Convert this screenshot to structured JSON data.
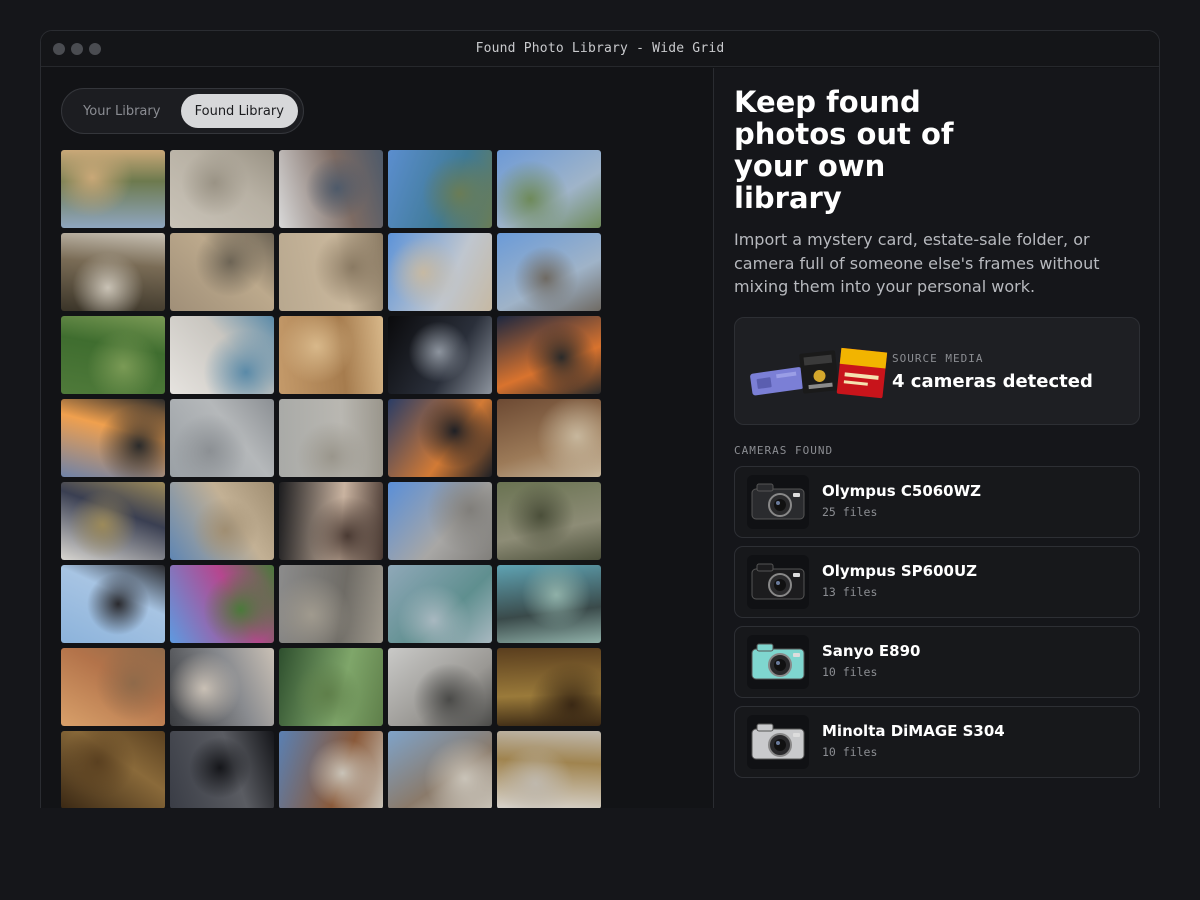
{
  "window": {
    "title": "Found Photo Library - Wide Grid"
  },
  "library_toggle": {
    "options": [
      "Your Library",
      "Found Library"
    ],
    "selected": "Found Library"
  },
  "photo_grid": {
    "tiles": [
      {
        "subject": "playground with kids and balloons",
        "colors": [
          "#8fa6c0",
          "#6d7a4e",
          "#c9a878"
        ]
      },
      {
        "subject": "sand drawing on beach",
        "colors": [
          "#c9c3b8",
          "#b8b1a4",
          "#9a9385"
        ]
      },
      {
        "subject": "photo collage poster on stand",
        "colors": [
          "#d8d8d8",
          "#7d6b63",
          "#4e5a6a"
        ]
      },
      {
        "subject": "resort pool with palm trees",
        "colors": [
          "#5b8ecf",
          "#3f7a95",
          "#6a7c56"
        ]
      },
      {
        "subject": "coastal lawn and blue sky",
        "colors": [
          "#6d9ad6",
          "#9fb4c9",
          "#6e8a5a"
        ]
      },
      {
        "subject": "kids at picnic table",
        "colors": [
          "#3a3428",
          "#7a6c56",
          "#c9c2b5"
        ]
      },
      {
        "subject": "child on balance bike",
        "colors": [
          "#a08f78",
          "#bca98c",
          "#6d6455"
        ]
      },
      {
        "subject": "kids riding balance bikes",
        "colors": [
          "#b8a88f",
          "#c9b79c",
          "#8a7a63"
        ]
      },
      {
        "subject": "military cargo plane",
        "colors": [
          "#5d93d8",
          "#bfc6cf",
          "#c6b9a3"
        ]
      },
      {
        "subject": "vintage airplane nose",
        "colors": [
          "#6b9bd8",
          "#9fb3c8",
          "#6f6a63"
        ]
      },
      {
        "subject": "garden lawn with chairs",
        "colors": [
          "#4f7a3a",
          "#3f6d2f",
          "#7a9a55"
        ]
      },
      {
        "subject": "birthday cakes on table",
        "colors": [
          "#e6e3df",
          "#c9c6c0",
          "#5a8aa8"
        ]
      },
      {
        "subject": "blurry party lights",
        "colors": [
          "#c49a6a",
          "#a67c4e",
          "#d8b88a"
        ]
      },
      {
        "subject": "palm frond at night",
        "colors": [
          "#0a0a0c",
          "#2a2f3a",
          "#8d949e"
        ]
      },
      {
        "subject": "sunset over hills",
        "colors": [
          "#1d2740",
          "#d9732e",
          "#2a2a2a"
        ]
      },
      {
        "subject": "sunset over ocean",
        "colors": [
          "#6e82a8",
          "#f0a04e",
          "#2b2b2b"
        ]
      },
      {
        "subject": "foggy sky and kite",
        "colors": [
          "#9aa0a5",
          "#b5b8ba",
          "#8c9094"
        ]
      },
      {
        "subject": "hazy beach",
        "colors": [
          "#a9aaa7",
          "#b9b7b1",
          "#9a968c"
        ]
      },
      {
        "subject": "dusk sky over sea",
        "colors": [
          "#2b3d66",
          "#d27a35",
          "#1f2025"
        ]
      },
      {
        "subject": "living room interior",
        "colors": [
          "#6d4a33",
          "#9c7a58",
          "#c7b79d"
        ]
      },
      {
        "subject": "framed ship painting",
        "colors": [
          "#d8d6d1",
          "#3a3f52",
          "#9c8a5a"
        ]
      },
      {
        "subject": "person walking on beach",
        "colors": [
          "#5f86b3",
          "#c3b195",
          "#a08e72"
        ]
      },
      {
        "subject": "woman portrait",
        "colors": [
          "#1d1d1f",
          "#c9b3a0",
          "#4a3a33"
        ]
      },
      {
        "subject": "stone sculpture",
        "colors": [
          "#5a8fd8",
          "#a8a7a5",
          "#807e7a"
        ]
      },
      {
        "subject": "bare branches",
        "colors": [
          "#6a7352",
          "#8d8c76",
          "#4b4f3a"
        ]
      },
      {
        "subject": "two birds on post",
        "colors": [
          "#8cb3db",
          "#a7c4e3",
          "#2a2a2e"
        ]
      },
      {
        "subject": "bougainvillea and house",
        "colors": [
          "#5e9ae0",
          "#b5478f",
          "#4a7a3a"
        ]
      },
      {
        "subject": "rocky shoreline",
        "colors": [
          "#8c8c8c",
          "#6f6c66",
          "#a09a8e"
        ]
      },
      {
        "subject": "sea with windsurfers",
        "colors": [
          "#8fa8b8",
          "#5f8f8f",
          "#a8b8c0"
        ]
      },
      {
        "subject": "road through car windshield",
        "colors": [
          "#5fa3b3",
          "#3a4a4a",
          "#8fb0a8"
        ]
      },
      {
        "subject": "toddler indoors",
        "colors": [
          "#d8a06a",
          "#b3734a",
          "#8f6a4a"
        ]
      },
      {
        "subject": "woman in car",
        "colors": [
          "#3a3c40",
          "#8a8c90",
          "#c9c0b5"
        ]
      },
      {
        "subject": "park lawn under trees",
        "colors": [
          "#2e4f2e",
          "#7fa66a",
          "#5f7f4a"
        ]
      },
      {
        "subject": "crow on pavement",
        "colors": [
          "#c9c9c7",
          "#9a9894",
          "#4a4a48"
        ]
      },
      {
        "subject": "mounted cattle head",
        "colors": [
          "#5a3e1e",
          "#9a7a3a",
          "#3a2814"
        ]
      },
      {
        "subject": "longhorn skull on wall",
        "colors": [
          "#3a2814",
          "#8a6a3a",
          "#5a4020"
        ]
      },
      {
        "subject": "dark dusk sky",
        "colors": [
          "#3a3d46",
          "#5a5c62",
          "#15161a"
        ]
      },
      {
        "subject": "classroom interior",
        "colors": [
          "#5a80b3",
          "#8a5a3a",
          "#c9c3b8"
        ]
      },
      {
        "subject": "meeting room chairs",
        "colors": [
          "#7fa3c9",
          "#8a7a6a",
          "#c9c3b8"
        ]
      },
      {
        "subject": "rows of chairs in hall",
        "colors": [
          "#d8d4ce",
          "#a0844f",
          "#bfb8ad"
        ]
      }
    ]
  },
  "hero": {
    "headline": "Keep found photos out of your own library",
    "description": "Import a mystery card, estate-sale folder, or camera full of someone else's frames without mixing them into your personal work."
  },
  "source_media": {
    "label": "SOURCE MEDIA",
    "value": "4 cameras detected"
  },
  "cameras": {
    "header": "CAMERAS FOUND",
    "items": [
      {
        "name": "Olympus C5060WZ",
        "files": "25 files",
        "icon": "camera-icon",
        "body_color": "#2a2b2e"
      },
      {
        "name": "Olympus SP600UZ",
        "files": "13 files",
        "icon": "camera-icon",
        "body_color": "#1c1c1e"
      },
      {
        "name": "Sanyo E890",
        "files": "10 files",
        "icon": "camera-icon",
        "body_color": "#7fd6cf"
      },
      {
        "name": "Minolta DiMAGE S304",
        "files": "10 files",
        "icon": "camera-icon",
        "body_color": "#c9cacc"
      }
    ]
  },
  "colors": {
    "background": "#15161a",
    "panel": "#121316",
    "card": "#1e1f23",
    "toggle_active": "#d7d8da"
  }
}
